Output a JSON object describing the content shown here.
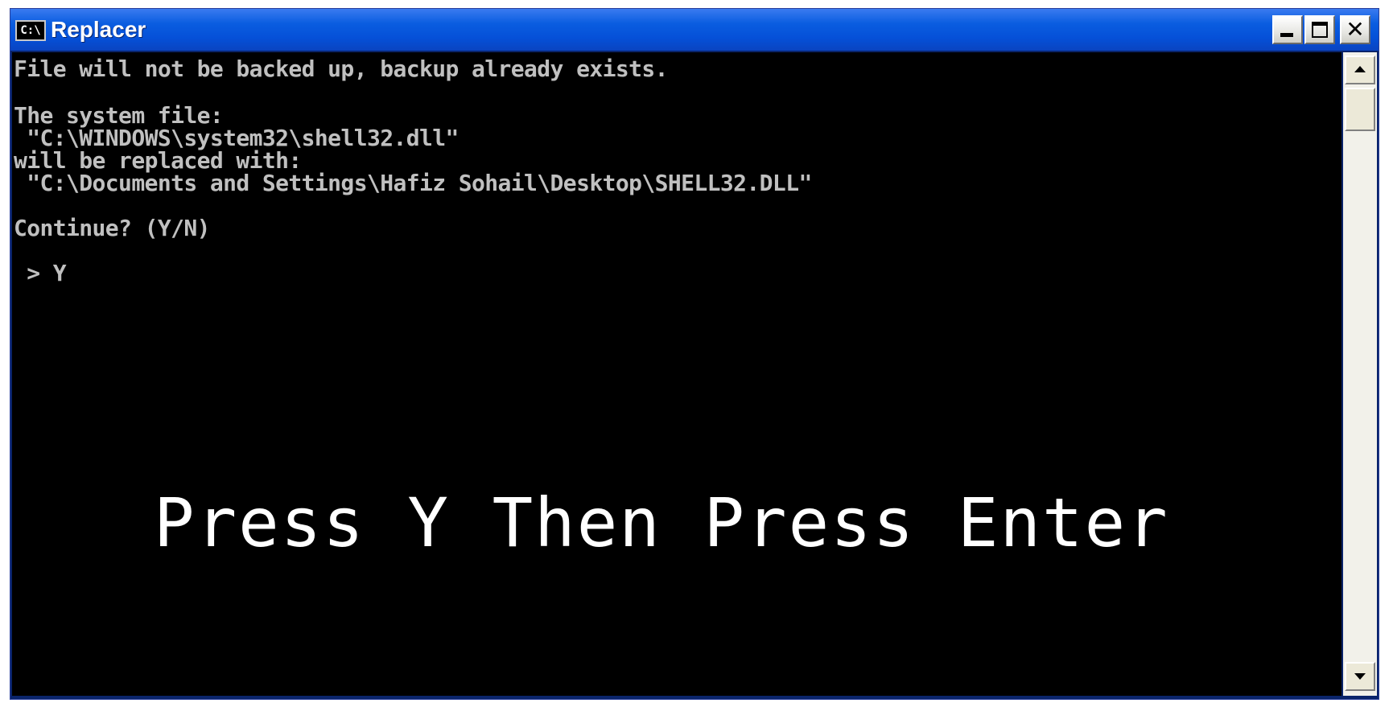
{
  "window": {
    "title": "Replacer",
    "icon_label": "C:\\",
    "icon": "command-prompt-icon",
    "controls": {
      "minimize": "minimize-icon",
      "maximize": "maximize-icon",
      "close_label": "✕",
      "close": "close-icon"
    }
  },
  "console": {
    "lines": [
      "File will not be backed up, backup already exists.",
      "",
      "The system file:",
      " \"C:\\WINDOWS\\system32\\shell32.dll\"",
      "will be replaced with:",
      " \"C:\\Documents and Settings\\Hafiz Sohail\\Desktop\\SHELL32.DLL\"",
      "",
      "Continue? (Y/N)",
      "",
      " > Y"
    ]
  },
  "overlay": {
    "instruction": "Press Y Then Press Enter"
  },
  "colors": {
    "titlebar": "#0550d8",
    "console_bg": "#000000",
    "console_text": "#c0c0c0",
    "overlay_text": "#ffffff"
  }
}
